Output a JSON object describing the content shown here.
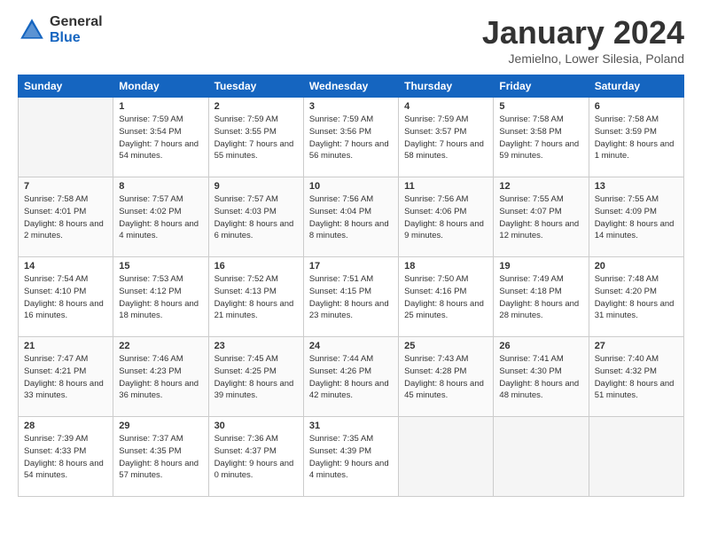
{
  "header": {
    "logo_general": "General",
    "logo_blue": "Blue",
    "title": "January 2024",
    "location": "Jemielno, Lower Silesia, Poland"
  },
  "days_of_week": [
    "Sunday",
    "Monday",
    "Tuesday",
    "Wednesday",
    "Thursday",
    "Friday",
    "Saturday"
  ],
  "weeks": [
    [
      {
        "num": "",
        "empty": true
      },
      {
        "num": "1",
        "sunrise": "7:59 AM",
        "sunset": "3:54 PM",
        "daylight": "7 hours and 54 minutes."
      },
      {
        "num": "2",
        "sunrise": "7:59 AM",
        "sunset": "3:55 PM",
        "daylight": "7 hours and 55 minutes."
      },
      {
        "num": "3",
        "sunrise": "7:59 AM",
        "sunset": "3:56 PM",
        "daylight": "7 hours and 56 minutes."
      },
      {
        "num": "4",
        "sunrise": "7:59 AM",
        "sunset": "3:57 PM",
        "daylight": "7 hours and 58 minutes."
      },
      {
        "num": "5",
        "sunrise": "7:58 AM",
        "sunset": "3:58 PM",
        "daylight": "7 hours and 59 minutes."
      },
      {
        "num": "6",
        "sunrise": "7:58 AM",
        "sunset": "3:59 PM",
        "daylight": "8 hours and 1 minute."
      }
    ],
    [
      {
        "num": "7",
        "sunrise": "7:58 AM",
        "sunset": "4:01 PM",
        "daylight": "8 hours and 2 minutes."
      },
      {
        "num": "8",
        "sunrise": "7:57 AM",
        "sunset": "4:02 PM",
        "daylight": "8 hours and 4 minutes."
      },
      {
        "num": "9",
        "sunrise": "7:57 AM",
        "sunset": "4:03 PM",
        "daylight": "8 hours and 6 minutes."
      },
      {
        "num": "10",
        "sunrise": "7:56 AM",
        "sunset": "4:04 PM",
        "daylight": "8 hours and 8 minutes."
      },
      {
        "num": "11",
        "sunrise": "7:56 AM",
        "sunset": "4:06 PM",
        "daylight": "8 hours and 9 minutes."
      },
      {
        "num": "12",
        "sunrise": "7:55 AM",
        "sunset": "4:07 PM",
        "daylight": "8 hours and 12 minutes."
      },
      {
        "num": "13",
        "sunrise": "7:55 AM",
        "sunset": "4:09 PM",
        "daylight": "8 hours and 14 minutes."
      }
    ],
    [
      {
        "num": "14",
        "sunrise": "7:54 AM",
        "sunset": "4:10 PM",
        "daylight": "8 hours and 16 minutes."
      },
      {
        "num": "15",
        "sunrise": "7:53 AM",
        "sunset": "4:12 PM",
        "daylight": "8 hours and 18 minutes."
      },
      {
        "num": "16",
        "sunrise": "7:52 AM",
        "sunset": "4:13 PM",
        "daylight": "8 hours and 21 minutes."
      },
      {
        "num": "17",
        "sunrise": "7:51 AM",
        "sunset": "4:15 PM",
        "daylight": "8 hours and 23 minutes."
      },
      {
        "num": "18",
        "sunrise": "7:50 AM",
        "sunset": "4:16 PM",
        "daylight": "8 hours and 25 minutes."
      },
      {
        "num": "19",
        "sunrise": "7:49 AM",
        "sunset": "4:18 PM",
        "daylight": "8 hours and 28 minutes."
      },
      {
        "num": "20",
        "sunrise": "7:48 AM",
        "sunset": "4:20 PM",
        "daylight": "8 hours and 31 minutes."
      }
    ],
    [
      {
        "num": "21",
        "sunrise": "7:47 AM",
        "sunset": "4:21 PM",
        "daylight": "8 hours and 33 minutes."
      },
      {
        "num": "22",
        "sunrise": "7:46 AM",
        "sunset": "4:23 PM",
        "daylight": "8 hours and 36 minutes."
      },
      {
        "num": "23",
        "sunrise": "7:45 AM",
        "sunset": "4:25 PM",
        "daylight": "8 hours and 39 minutes."
      },
      {
        "num": "24",
        "sunrise": "7:44 AM",
        "sunset": "4:26 PM",
        "daylight": "8 hours and 42 minutes."
      },
      {
        "num": "25",
        "sunrise": "7:43 AM",
        "sunset": "4:28 PM",
        "daylight": "8 hours and 45 minutes."
      },
      {
        "num": "26",
        "sunrise": "7:41 AM",
        "sunset": "4:30 PM",
        "daylight": "8 hours and 48 minutes."
      },
      {
        "num": "27",
        "sunrise": "7:40 AM",
        "sunset": "4:32 PM",
        "daylight": "8 hours and 51 minutes."
      }
    ],
    [
      {
        "num": "28",
        "sunrise": "7:39 AM",
        "sunset": "4:33 PM",
        "daylight": "8 hours and 54 minutes."
      },
      {
        "num": "29",
        "sunrise": "7:37 AM",
        "sunset": "4:35 PM",
        "daylight": "8 hours and 57 minutes."
      },
      {
        "num": "30",
        "sunrise": "7:36 AM",
        "sunset": "4:37 PM",
        "daylight": "9 hours and 0 minutes."
      },
      {
        "num": "31",
        "sunrise": "7:35 AM",
        "sunset": "4:39 PM",
        "daylight": "9 hours and 4 minutes."
      },
      {
        "num": "",
        "empty": true
      },
      {
        "num": "",
        "empty": true
      },
      {
        "num": "",
        "empty": true
      }
    ]
  ]
}
